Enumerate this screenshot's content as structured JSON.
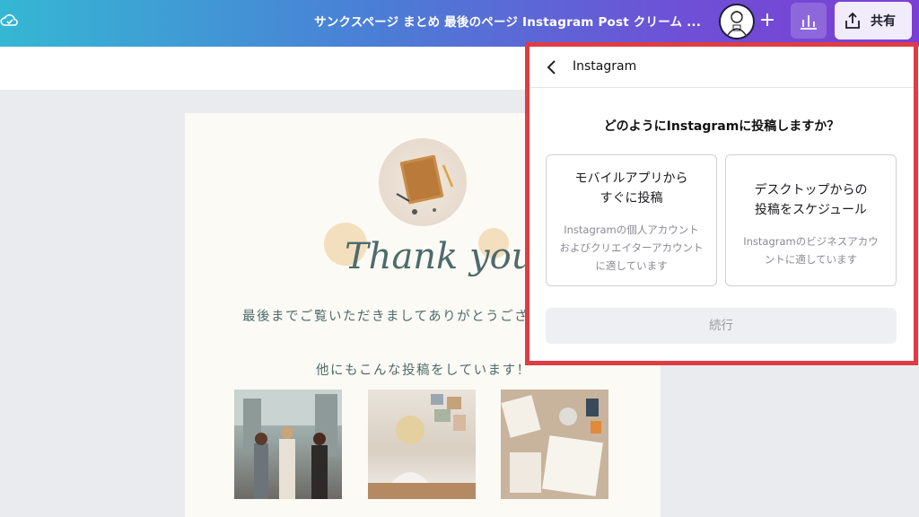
{
  "topbar": {
    "document_title": "サンクスページ まとめ 最後のページ Instagram Post クリーム ...",
    "cloud_icon": "cloud-saved-icon",
    "plus_label": "+",
    "insights_icon": "bar-chart-icon",
    "share_icon": "share-upload-icon",
    "share_label": "共有",
    "accent_gradient": [
      "#35b7d3",
      "#4a7fd6",
      "#7b3fd3"
    ]
  },
  "canvas": {
    "message_line1": "最後までご覧いただきましてありがとうござ",
    "message_line2": "他にもこんな投稿をしています！",
    "script_text": "Thank you!"
  },
  "instagram_panel": {
    "back_icon": "chevron-left-icon",
    "title": "Instagram",
    "question": "どのようにInstagramに投稿しますか？",
    "options": [
      {
        "title_line1": "モバイルアプリから",
        "title_line2": "すぐに投稿",
        "desc_line1": "Instagramの個人アカウント",
        "desc_line2": "およびクリエイターアカウント",
        "desc_line3": "に適しています"
      },
      {
        "title_line1": "デスクトップからの",
        "title_line2": "投稿をスケジュール",
        "desc_line1": "Instagramのビジネスアカウ",
        "desc_line2": "ントに適しています"
      }
    ],
    "continue_label": "続行",
    "highlight_color": "#df3c45"
  }
}
